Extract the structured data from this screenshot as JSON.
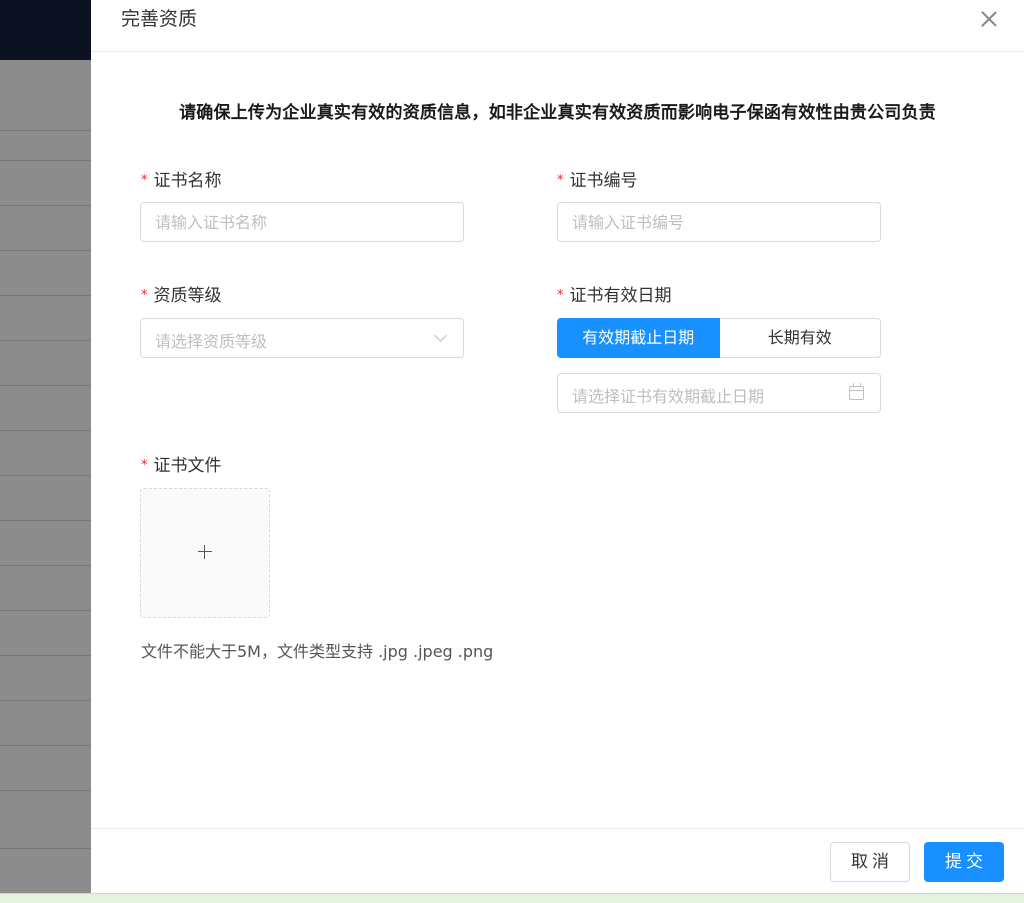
{
  "drawer": {
    "title": "完善资质",
    "notice": "请确保上传为企业真实有效的资质信息，如非企业真实有效资质而影响电子保函有效性由贵公司负责"
  },
  "form": {
    "required_mark": "*",
    "cert_name": {
      "label": "证书名称",
      "placeholder": "请输入证书名称",
      "value": ""
    },
    "cert_number": {
      "label": "证书编号",
      "placeholder": "请输入证书编号",
      "value": ""
    },
    "qualification_level": {
      "label": "资质等级",
      "placeholder": "请选择资质等级"
    },
    "validity": {
      "label": "证书有效日期",
      "options": [
        "有效期截止日期",
        "长期有效"
      ],
      "selected": "有效期截止日期",
      "date_placeholder": "请选择证书有效期截止日期"
    },
    "cert_file": {
      "label": "证书文件",
      "hint": "文件不能大于5M，文件类型支持 .jpg .jpeg .png"
    }
  },
  "footer": {
    "cancel_label": "取消",
    "submit_label": "提交"
  },
  "colors": {
    "primary": "#1890ff",
    "required": "#f5222d",
    "header_bg": "#16213d"
  }
}
